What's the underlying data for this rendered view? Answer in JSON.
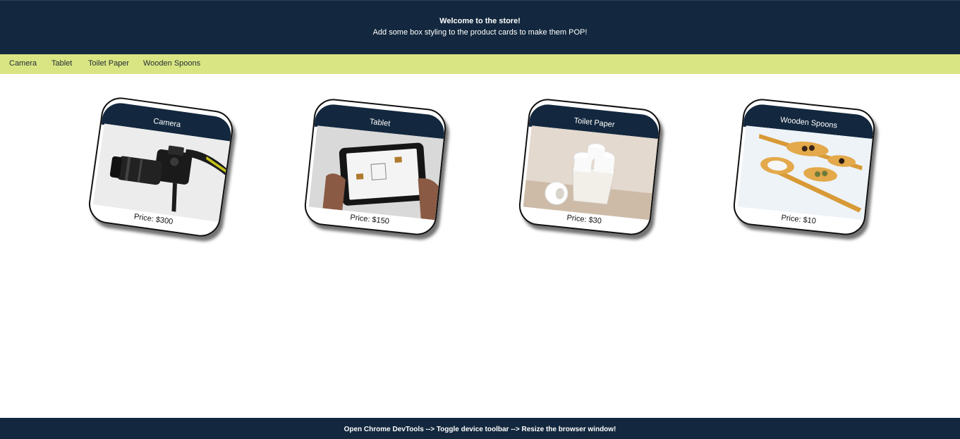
{
  "header": {
    "title": "Welcome to the store!",
    "subtitle": "Add some box styling to the product cards to make them POP!"
  },
  "nav": {
    "items": [
      "Camera",
      "Tablet",
      "Toilet Paper",
      "Wooden Spoons"
    ]
  },
  "products": [
    {
      "name": "Camera",
      "price": "Price: $300",
      "image_icon": "camera-photo"
    },
    {
      "name": "Tablet",
      "price": "Price: $150",
      "image_icon": "tablet-photo"
    },
    {
      "name": "Toilet Paper",
      "price": "Price: $30",
      "image_icon": "toilet-paper-photo"
    },
    {
      "name": "Wooden Spoons",
      "price": "Price: $10",
      "image_icon": "wooden-spoons-photo"
    }
  ],
  "footer": {
    "text": "Open Chrome DevTools --> Toggle device toolbar --> Resize the browser window!"
  },
  "colors": {
    "dark_navy": "#13283e",
    "nav_lime": "#d9e582",
    "background": "#ffffff"
  }
}
